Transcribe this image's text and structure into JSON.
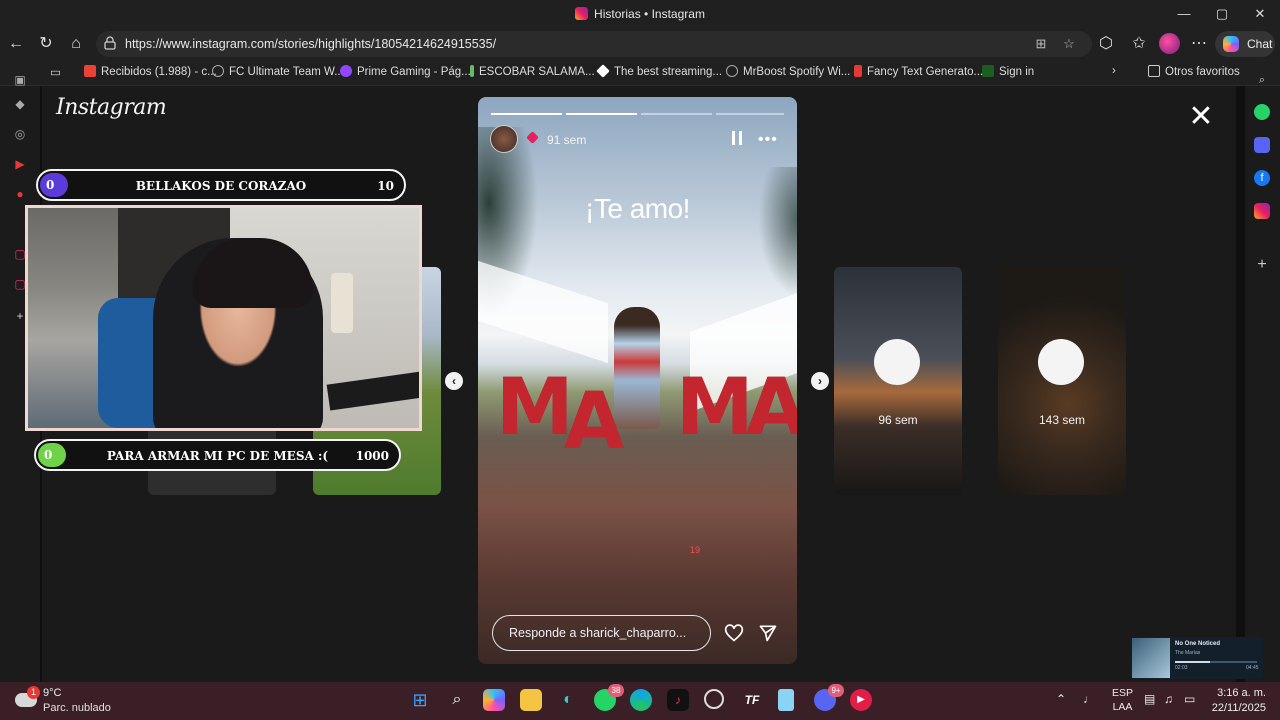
{
  "window": {
    "title": "Historias • Instagram"
  },
  "address": {
    "url": "https://www.instagram.com/stories/highlights/18054214624915535/"
  },
  "toolbar": {
    "chat_label": "Chat"
  },
  "bookmarks": [
    {
      "label": "Recibidos (1.988) - c...",
      "color": "#ea4335"
    },
    {
      "label": "FC Ultimate Team W...",
      "color": "#9aa0a6"
    },
    {
      "label": "Prime Gaming - Pág...",
      "color": "#9146ff"
    },
    {
      "label": "ESCOBAR SALAMA...",
      "color": "#66bb6a"
    },
    {
      "label": "The best streaming...",
      "color": "#ffffff"
    },
    {
      "label": "MrBoost Spotify Wi...",
      "color": "#9aa0a6"
    },
    {
      "label": "Fancy Text Generato...",
      "color": "#e53935"
    },
    {
      "label": "Sign in",
      "color": "#2e7d32"
    }
  ],
  "bookmarks_other": "Otros favoritos",
  "instagram": {
    "logo": "Instagram",
    "story": {
      "time": "91 sem",
      "text": "¡Te amo!",
      "letters": [
        "M",
        "A",
        "M",
        "A"
      ],
      "floor_number": "19",
      "reply_placeholder": "Responde a sharick_chaparro...",
      "progress_done": 2,
      "progress_total": 4
    },
    "next_stories": [
      {
        "time": "96 sem"
      },
      {
        "time": "143 sem"
      }
    ]
  },
  "overlay": {
    "goal_top": {
      "current": "0",
      "title": "BELLAKOS DE CORAZAO",
      "target": "10",
      "color": "#5b3bd9"
    },
    "goal_bottom": {
      "current": "0",
      "title": "PARA ARMAR MI PC DE MESA :(",
      "target": "1000",
      "color": "#6fd34a"
    }
  },
  "media_player": {
    "title": "No One Noticed",
    "artist": "The Marías",
    "elapsed": "02:03",
    "duration": "04:45",
    "progress": 0.43
  },
  "taskbar": {
    "weather_badge": "1",
    "temperature": "9°C",
    "weather_desc": "Parc. nublado",
    "whatsapp_badge": "38",
    "discord_badge": "9+",
    "lang_top": "ESP",
    "lang_bottom": "LAA",
    "time": "3:16 a. m.",
    "date": "22/11/2025"
  }
}
